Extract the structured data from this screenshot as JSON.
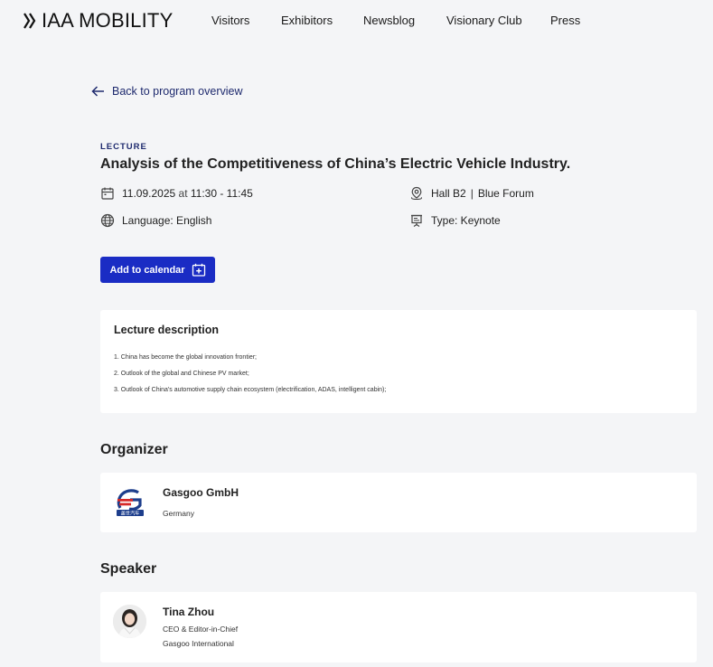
{
  "header": {
    "logo_text": "IAA MOBILITY",
    "nav": [
      "Visitors",
      "Exhibitors",
      "Newsblog",
      "Visionary Club",
      "Press"
    ]
  },
  "back_link": "Back to program overview",
  "event": {
    "category": "LECTURE",
    "title": "Analysis of the Competitiveness of China’s Electric Vehicle Industry.",
    "date": "11.09.2025",
    "at": "at",
    "time": "11:30 - 11:45",
    "hall": "Hall B2",
    "separator": "|",
    "forum": "Blue Forum",
    "language": "Language: English",
    "type": "Type: Keynote"
  },
  "calendar_button": "Add to calendar",
  "description": {
    "title": "Lecture description",
    "lines": [
      "1. China has become the global innovation frontier;",
      "2. Outlook of the global and Chinese PV market;",
      "3. Outlook of China's automotive supply chain ecosystem (electrification, ADAS, intelligent cabin);"
    ]
  },
  "organizer": {
    "section_title": "Organizer",
    "name": "Gasgoo GmbH",
    "country": "Germany",
    "logo_text": "盖世汽车"
  },
  "speaker": {
    "section_title": "Speaker",
    "name": "Tina Zhou",
    "role": "CEO & Editor-in-Chief",
    "company": "Gasgoo International"
  },
  "colors": {
    "accent": "#1a2cc4",
    "link": "#1e2a6e",
    "background": "#f4f5f7"
  },
  "icons": [
    "double-chevron-logo-icon",
    "arrow-left-icon",
    "calendar-icon",
    "location-pin-icon",
    "globe-icon",
    "presentation-icon",
    "calendar-plus-icon"
  ]
}
